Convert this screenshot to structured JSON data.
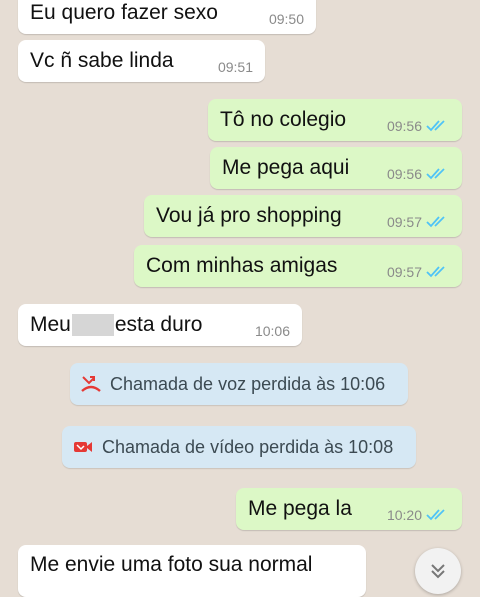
{
  "messages": [
    {
      "text": "Eu quero fazer sexo",
      "time": "09:50"
    },
    {
      "text": "Vc ñ sabe linda",
      "time": "09:51"
    },
    {
      "text": "Tô no colegio",
      "time": "09:56"
    },
    {
      "text": "Me pega aqui",
      "time": "09:56"
    },
    {
      "text": "Vou já pro shopping",
      "time": "09:57"
    },
    {
      "text": "Com minhas amigas",
      "time": "09:57"
    },
    {
      "text_before": "Meu",
      "text_after": "esta duro",
      "time": "10:06"
    },
    {
      "text": "Me pega la",
      "time": "10:20"
    },
    {
      "text": "Me envie uma foto sua normal"
    }
  ],
  "system_notices": [
    {
      "text": "Chamada de voz perdida às 10:06",
      "icon": "missed-voice-call-icon"
    },
    {
      "text": "Chamada de vídeo perdida às 10:08",
      "icon": "missed-video-call-icon"
    }
  ],
  "colors": {
    "background": "#e6ddd4",
    "incoming_bubble": "#ffffff",
    "outgoing_bubble": "#dcf8c6",
    "system_bubble": "#d6e8f4",
    "read_ticks": "#4fc3f7",
    "missed_call": "#e53935"
  },
  "scroll_button": {
    "icon": "double-chevron-down-icon"
  }
}
